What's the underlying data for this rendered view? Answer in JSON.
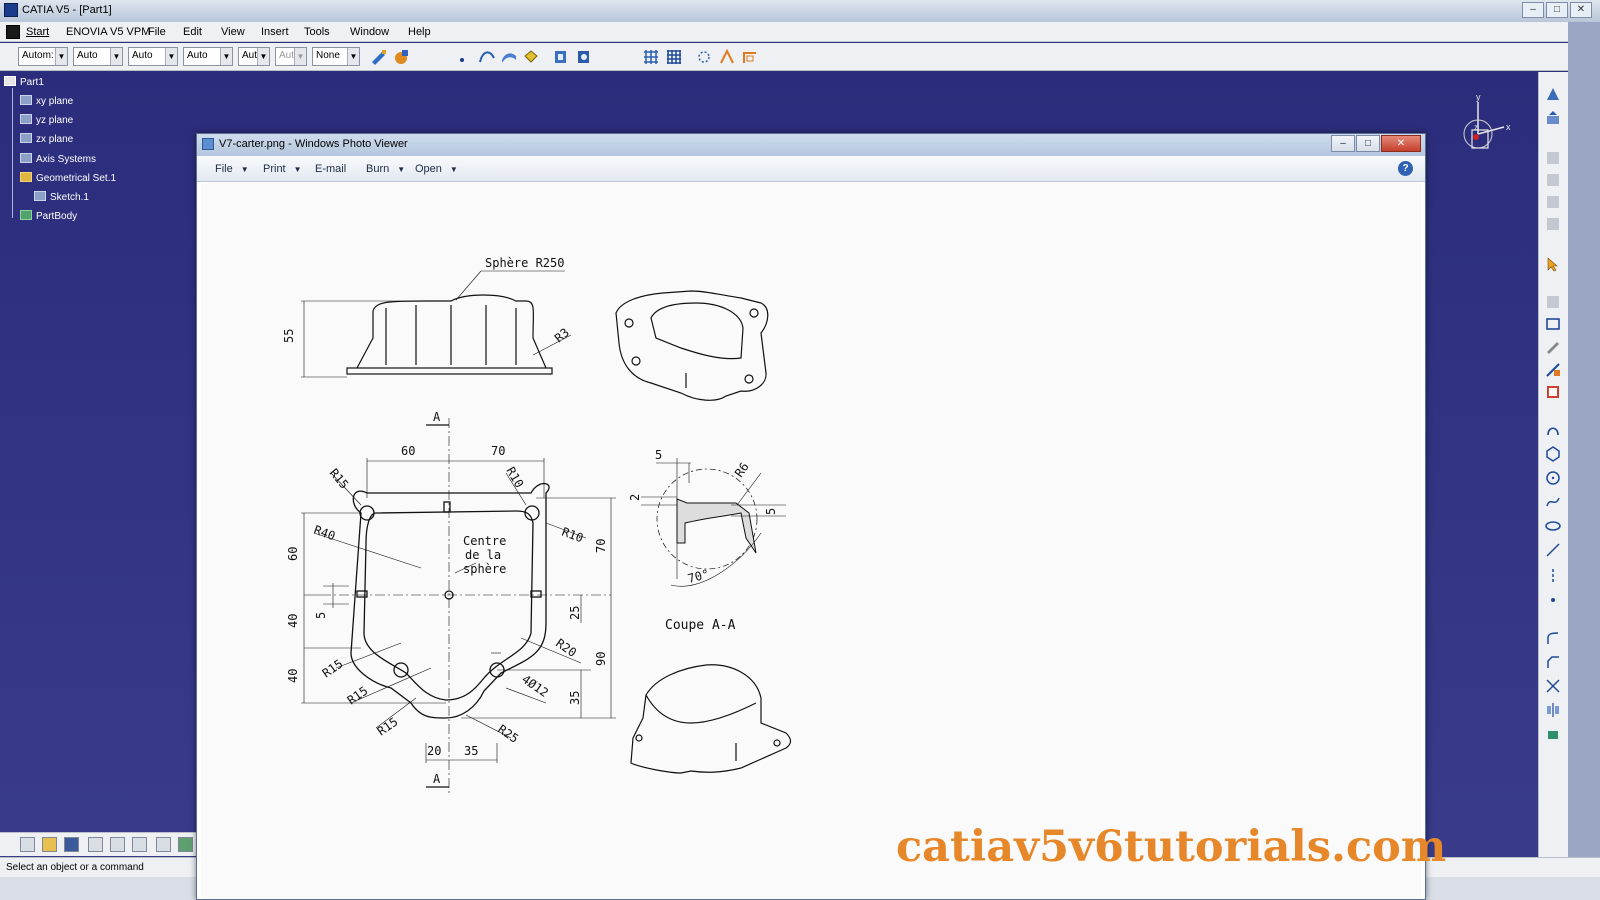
{
  "catia": {
    "window_title": "CATIA V5 - [Part1]",
    "menu": [
      "Start",
      "ENOVIA V5 VPM",
      "File",
      "Edit",
      "View",
      "Insert",
      "Tools",
      "Window",
      "Help"
    ],
    "combos": [
      "Autom:",
      "Auto",
      "Auto",
      "Auto",
      "Aut",
      "Aut",
      "None"
    ],
    "tree": {
      "root": "Part1",
      "items": [
        "xy plane",
        "yz plane",
        "zx plane",
        "Axis Systems",
        "Geometrical Set.1",
        "Sketch.1",
        "PartBody"
      ]
    },
    "compass": {
      "x": "x",
      "y": "y",
      "z": "z"
    },
    "status_text": "Select an object or a command",
    "logo": "CATIA"
  },
  "photo_viewer": {
    "title": "V7-carter.png - Windows Photo Viewer",
    "menu": [
      "File",
      "Print",
      "E-mail",
      "Burn",
      "Open"
    ],
    "menu_has_dropdown": [
      true,
      true,
      false,
      true,
      true
    ],
    "help": "?"
  },
  "drawing": {
    "labels": {
      "sphere": "Sphère R250",
      "h55": "55",
      "r3": "R3",
      "sectionA_top": "A",
      "sectionA_bottom": "A",
      "d60": "60",
      "d70": "70",
      "r15_top": "R15",
      "r10_top": "R10",
      "r10_right": "R10",
      "r40": "R40",
      "centre1": "Centre",
      "centre2": "de la",
      "centre3": "sphère",
      "v60": "60",
      "v40a": "40",
      "v5": "5",
      "v40b": "40",
      "v70": "70",
      "v25": "25",
      "v90": "90",
      "v35": "35",
      "r20": "R20",
      "hole": "4Ø12",
      "r15_a": "R15",
      "r15_b": "R15",
      "r15_c": "R15",
      "r25": "R25",
      "b20": "20",
      "b35": "35",
      "s5": "5",
      "s2": "2",
      "r6": "R6",
      "s5b": "5",
      "a70": "70°",
      "coupe": "Coupe A-A"
    }
  },
  "watermark": "catiav5v6tutorials.com"
}
